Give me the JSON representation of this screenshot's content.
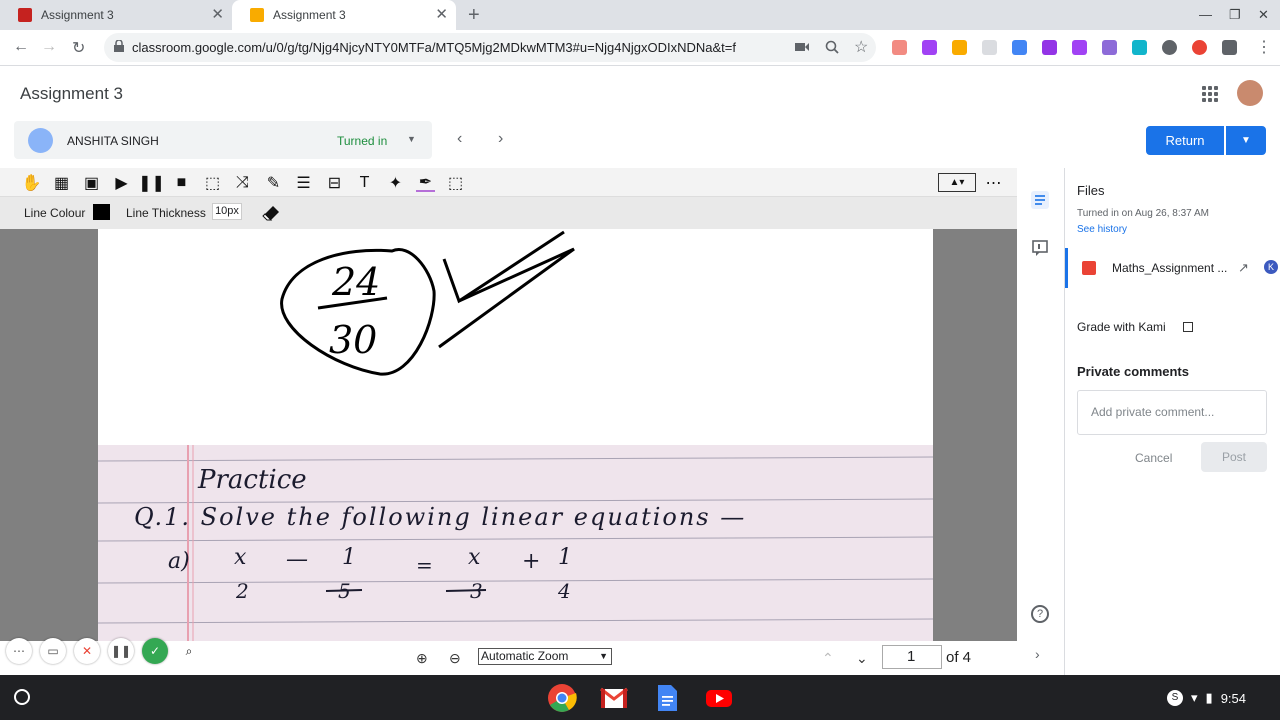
{
  "browser": {
    "tabs": [
      {
        "title": "Assignment 3",
        "active": false
      },
      {
        "title": "Assignment 3",
        "active": true
      }
    ],
    "url": "classroom.google.com/u/0/g/tg/Njg4NjcyNTY0MTFa/MTQ5Mjg2MDkwMTM3#u=Njg4NjgxODIxNDNa&t=f"
  },
  "header": {
    "title": "Assignment 3",
    "student_name": "ANSHITA SINGH",
    "status": "Turned in",
    "return_label": "Return"
  },
  "viewer": {
    "line_colour_label": "Line Colour",
    "line_colour": "#000000",
    "line_thickness_label": "Line Thickness",
    "line_thickness": "10px",
    "score_numerator": "24",
    "score_denominator": "30",
    "notebook": {
      "heading": "Practice",
      "question": "Q.1. Solve the following linear equations —",
      "part": "a)",
      "eq_lhs_a": "x",
      "eq_lhs_a_den": "2",
      "eq_lhs_b": "1",
      "eq_lhs_b_den": "5",
      "eq_rhs_a": "x",
      "eq_rhs_a_den": "3",
      "eq_rhs_b": "1",
      "eq_rhs_b_den": "4"
    },
    "zoom": "Automatic Zoom",
    "page_current": "1",
    "page_total_label": "of 4"
  },
  "side": {
    "files_heading": "Files",
    "turned_in_time": "Turned in on Aug 26, 8:37 AM",
    "see_history": "See history",
    "file_name": "Maths_Assignment ...",
    "grade_with_kami": "Grade with Kami",
    "private_comments": "Private comments",
    "comment_placeholder": "Add private comment...",
    "cancel": "Cancel",
    "post": "Post"
  },
  "shelf": {
    "time": "9:54"
  },
  "colors": {
    "accent": "#1a73e8",
    "turned_in": "#1e8e3e"
  }
}
